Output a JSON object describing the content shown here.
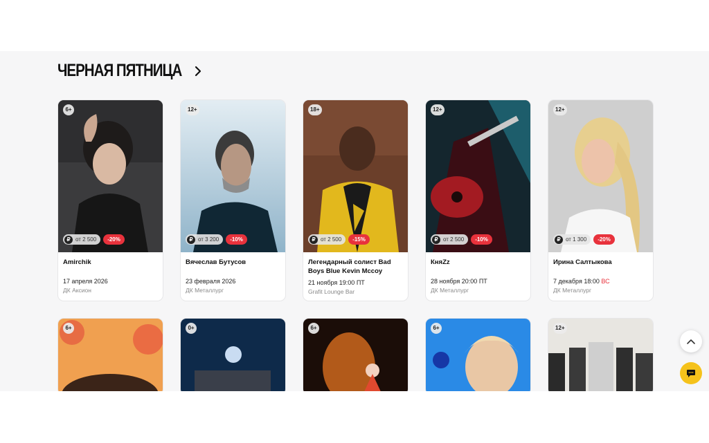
{
  "section": {
    "title": "ЧЕРНАЯ ПЯТНИЦА",
    "title_icon": "chevron-right-icon"
  },
  "currency_icon": "ruble-icon",
  "events": [
    {
      "age": "6+",
      "price": "от 2 500",
      "discount": "-20%",
      "title": "Amirchik",
      "date": "17 апреля 2026",
      "date_weekday": "",
      "venue": "ДК Аксион"
    },
    {
      "age": "12+",
      "price": "от 3 200",
      "discount": "-10%",
      "title": "Вячеслав Бутусов",
      "date": "23 февраля 2026",
      "date_weekday": "",
      "venue": "ДК Металлург"
    },
    {
      "age": "18+",
      "price": "от 2 500",
      "discount": "-15%",
      "title": "Легендарный солист Bad Boys Blue Kevin Mccoy",
      "date": "21 ноября 19:00 ПТ",
      "date_weekday": "",
      "venue": "Grafit Lounge Bar"
    },
    {
      "age": "12+",
      "price": "от 2 500",
      "discount": "-10%",
      "title": "КняZz",
      "date": "28 ноября 20:00 ПТ",
      "date_weekday": "",
      "venue": "ДК Металлург"
    },
    {
      "age": "12+",
      "price": "от 1 300",
      "discount": "-20%",
      "title": "Ирина Салтыкова",
      "date": "7 декабря 18:00",
      "date_weekday": "ВС",
      "venue": "ДК Металлург"
    }
  ],
  "events_row2": [
    {
      "age": "6+"
    },
    {
      "age": "0+"
    },
    {
      "age": "6+"
    },
    {
      "age": "6+"
    },
    {
      "age": "12+"
    }
  ],
  "buttons": {
    "scroll_top_icon": "chevron-up-icon",
    "chat_icon": "chat-icon"
  },
  "colors": {
    "accent": "#f5c21b",
    "discount": "#e8323c",
    "background": "#f6f6f7"
  }
}
